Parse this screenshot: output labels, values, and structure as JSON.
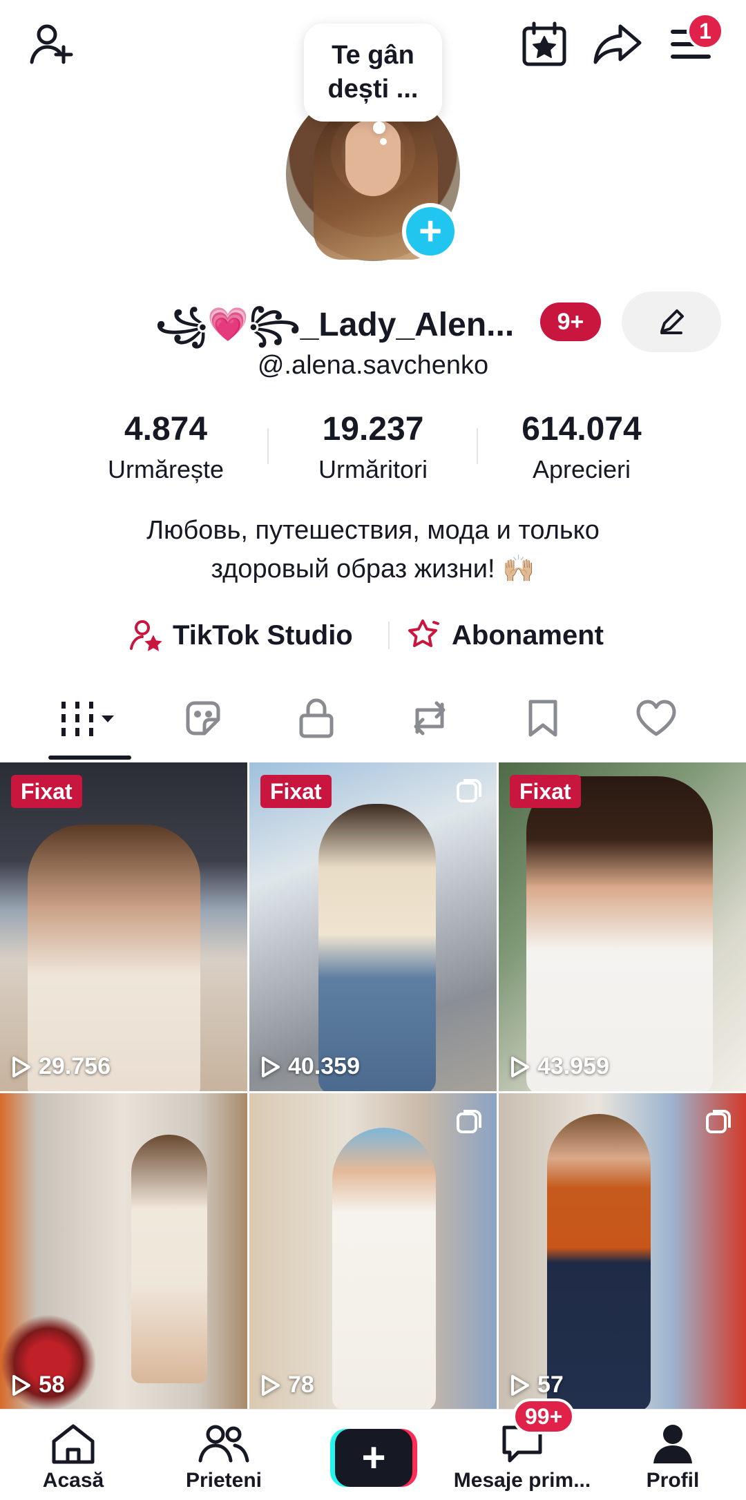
{
  "top_bar": {
    "menu_badge": "1",
    "note": "Te gân dești ..."
  },
  "profile": {
    "display_name": "꧁💗꧂_Lady_Alen...",
    "name_badge": "9+",
    "username": "@.alena.savchenko",
    "bio_line1": "Любовь, путешествия, мода и только",
    "bio_line2": "здоровый образ жизни! 🙌🏼"
  },
  "stats": [
    {
      "value": "4.874",
      "label": "Urmărește"
    },
    {
      "value": "19.237",
      "label": "Urmăritori"
    },
    {
      "value": "614.074",
      "label": "Aprecieri"
    }
  ],
  "links": {
    "studio": "TikTok Studio",
    "subscription": "Abonament"
  },
  "tabs": [
    "videos-grid-icon",
    "stickers-icon",
    "lock-icon",
    "repost-icon",
    "bookmark-icon",
    "heart-icon"
  ],
  "videos": [
    {
      "pinned": "Fixat",
      "views": "29.756",
      "multi": false
    },
    {
      "pinned": "Fixat",
      "views": "40.359",
      "multi": true
    },
    {
      "pinned": "Fixat",
      "views": "43.959",
      "multi": false
    },
    {
      "pinned": "",
      "views": "58",
      "multi": false
    },
    {
      "pinned": "",
      "views": "78",
      "multi": true
    },
    {
      "pinned": "",
      "views": "57",
      "multi": true
    }
  ],
  "bottom_nav": {
    "home": "Acasă",
    "friends": "Prieteni",
    "inbox": "Mesaje prim...",
    "inbox_badge": "99+",
    "profile": "Profil"
  },
  "colors": {
    "accent": "#c9163f",
    "badge": "#e0224a",
    "add_avatar": "#20c5f0",
    "text": "#161823"
  }
}
